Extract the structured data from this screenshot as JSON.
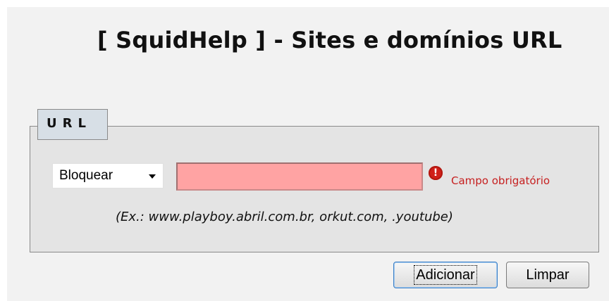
{
  "page": {
    "title": "[ SquidHelp ] - Sites e domínios URL"
  },
  "form": {
    "legend": "URL",
    "action_select": {
      "selected": "Bloquear"
    },
    "url_input": {
      "value": "",
      "status": "error"
    },
    "error_message": "Campo obrigatório",
    "example_hint": "(Ex.: www.playboy.abril.com.br, orkut.com, .youtube)"
  },
  "buttons": {
    "add_label": "Adicionar",
    "clear_label": "Limpar"
  },
  "icons": {
    "error": "exclamation-circle-icon",
    "select": "chevron-down-icon"
  },
  "colors": {
    "error_field_bg": "#ffa3a3",
    "error_text": "#c62020",
    "legend_bg": "#d7dfe6",
    "fieldset_bg": "#e4e4e4",
    "primary_button_border": "#3b7fc6"
  }
}
